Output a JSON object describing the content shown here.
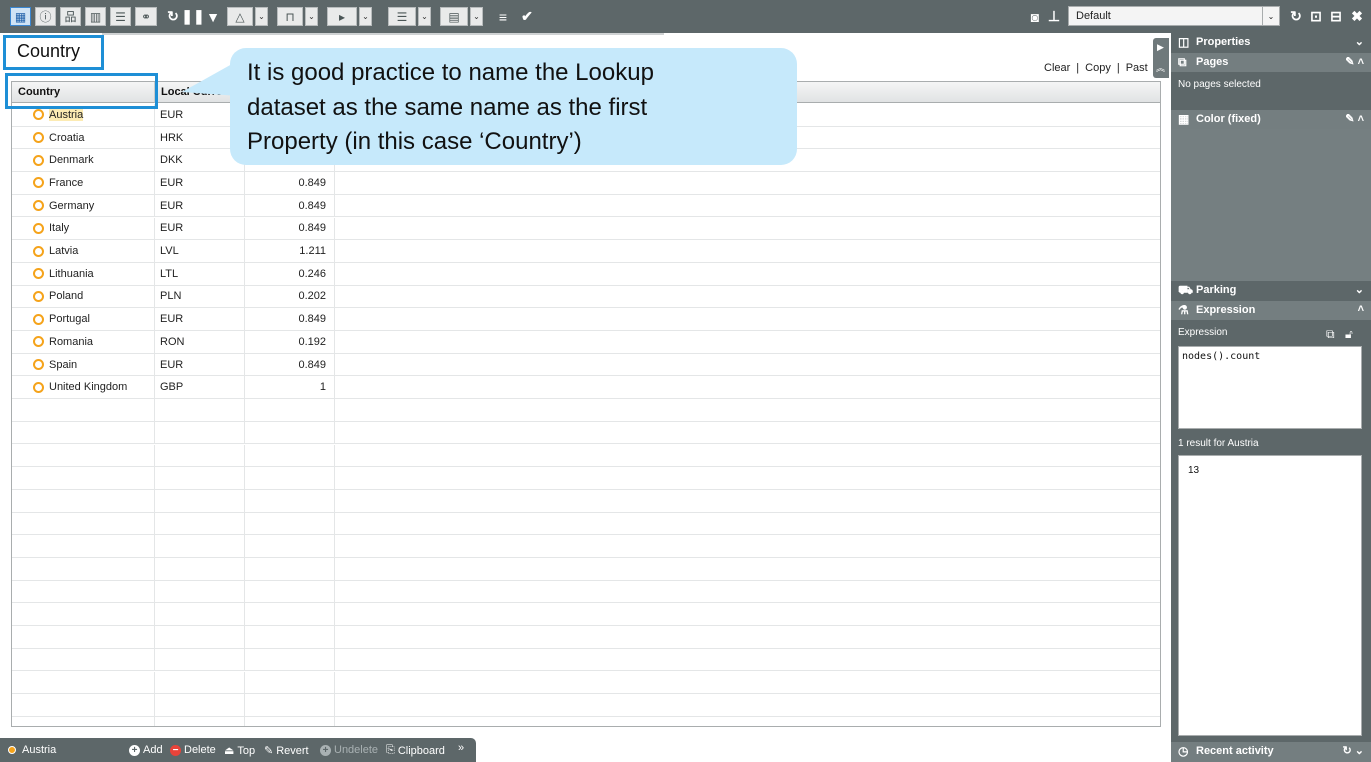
{
  "toolbar": {
    "view_select": "Default",
    "icons": [
      "table-view-icon",
      "info-icon",
      "hierarchy-icon",
      "bar-chart-icon",
      "list-icon",
      "link-icon",
      "refresh-icon",
      "pause-icon",
      "filter-icon",
      "triangle-icon",
      "bookmark-icon",
      "play-icon",
      "list-indent-icon",
      "table-icon",
      "menu-icon",
      "check-icon",
      "camera-icon",
      "pin-icon",
      "reload-icon",
      "save-as-icon",
      "save-icon",
      "close-icon"
    ]
  },
  "title": "Country",
  "clipboard_links": {
    "clear": "Clear",
    "copy": "Copy",
    "paste": "Past",
    "sep": "|"
  },
  "grid": {
    "columns": [
      "Country",
      "Local Curre"
    ],
    "rows": [
      {
        "country": "Austria",
        "currency": "EUR",
        "rate": ""
      },
      {
        "country": "Croatia",
        "currency": "HRK",
        "rate": ""
      },
      {
        "country": "Denmark",
        "currency": "DKK",
        "rate": ""
      },
      {
        "country": "France",
        "currency": "EUR",
        "rate": "0.849"
      },
      {
        "country": "Germany",
        "currency": "EUR",
        "rate": "0.849"
      },
      {
        "country": "Italy",
        "currency": "EUR",
        "rate": "0.849"
      },
      {
        "country": "Latvia",
        "currency": "LVL",
        "rate": "1.211"
      },
      {
        "country": "Lithuania",
        "currency": "LTL",
        "rate": "0.246"
      },
      {
        "country": "Poland",
        "currency": "PLN",
        "rate": "0.202"
      },
      {
        "country": "Portugal",
        "currency": "EUR",
        "rate": "0.849"
      },
      {
        "country": "Romania",
        "currency": "RON",
        "rate": "0.192"
      },
      {
        "country": "Spain",
        "currency": "EUR",
        "rate": "0.849"
      },
      {
        "country": "United Kingdom",
        "currency": "GBP",
        "rate": "1"
      }
    ],
    "empty_rows": 15
  },
  "callout": {
    "line1": "It is good practice to name the Lookup",
    "line2": "dataset as the same name as the first",
    "line3": "Property (in this case ‘Country’)"
  },
  "bottom_bar": {
    "current": "Austria",
    "add": "Add",
    "delete": "Delete",
    "top": "Top",
    "revert": "Revert",
    "undelete": "Undelete",
    "clipboard": "Clipboard",
    "more": "»"
  },
  "right_panel": {
    "properties": "Properties",
    "pages": "Pages",
    "pages_empty": "No pages selected",
    "color": "Color (fixed)",
    "parking": "Parking",
    "expression_header": "Expression",
    "expression_label": "Expression",
    "expression_value": "nodes().count",
    "result_label": "1 result for Austria",
    "result_value": "13",
    "recent_activity": "Recent activity"
  },
  "colors": {
    "toolbar_bg": "#5d6769",
    "highlight_border": "#1e8fd6",
    "callout_bg": "#c6e9fb",
    "node_color": "#f5a31a"
  }
}
